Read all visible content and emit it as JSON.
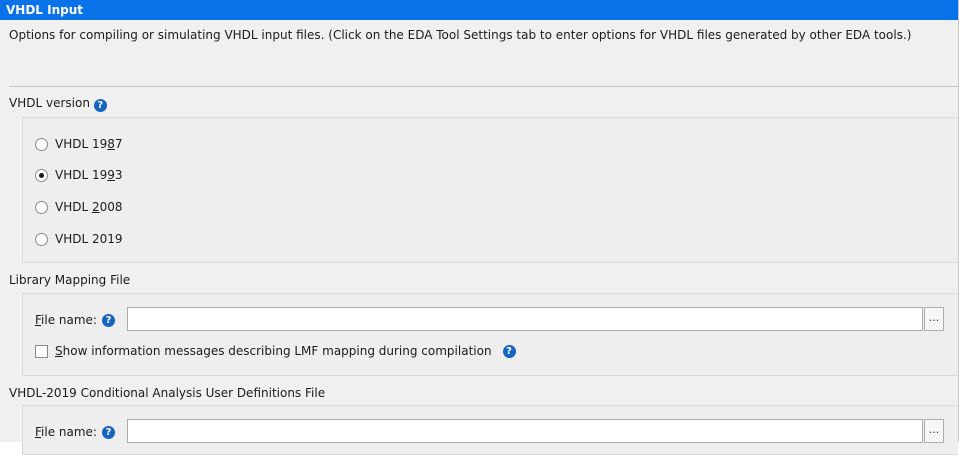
{
  "title": "VHDL Input",
  "description": "Options for compiling or simulating VHDL input files.  (Click on the EDA Tool Settings tab to enter options for VHDL files generated by other EDA tools.)",
  "vhdl_version": {
    "label": "VHDL version",
    "help_icon": "question-circle-icon",
    "options": [
      {
        "pre": "VHDL 19",
        "mnemonic": "8",
        "post": "7",
        "checked": false
      },
      {
        "pre": "VHDL 19",
        "mnemonic": "9",
        "post": "3",
        "checked": true
      },
      {
        "pre": "VHDL ",
        "mnemonic": "2",
        "post": "008",
        "checked": false
      },
      {
        "pre": "VHDL 2019",
        "mnemonic": "",
        "post": "",
        "checked": false
      }
    ]
  },
  "library_mapping": {
    "section_label": "Library Mapping File",
    "file_label_mnemonic": "F",
    "file_label_rest": "ile name:",
    "file_value": "",
    "browse_label": "...",
    "checkbox_mnemonic": "S",
    "checkbox_rest": "how information messages describing LMF mapping during compilation",
    "checkbox_checked": false
  },
  "conditional_analysis": {
    "section_label": "VHDL-2019 Conditional Analysis User Definitions File",
    "file_label_mnemonic": "F",
    "file_label_rest": "ile name:",
    "file_value": "",
    "browse_label": "..."
  },
  "colors": {
    "title_bar": "#0a72e8",
    "help_icon": "#1565c0",
    "panel_bg": "#f0f0f0"
  }
}
